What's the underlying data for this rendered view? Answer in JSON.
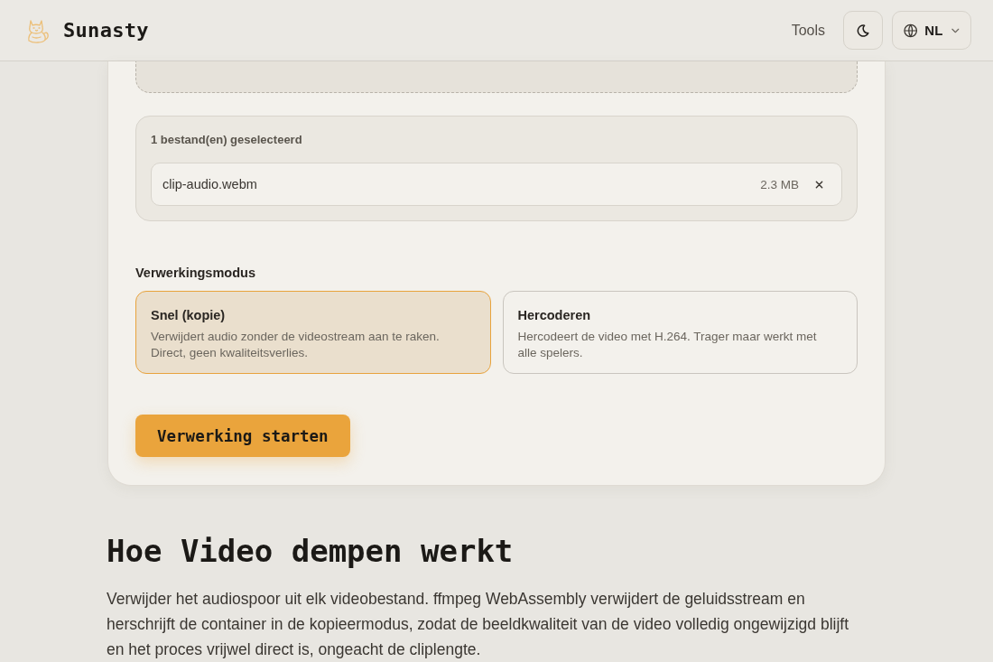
{
  "header": {
    "brand": "Sunasty",
    "nav": [
      {
        "label": "Tools"
      }
    ],
    "language": "NL"
  },
  "converter": {
    "files": {
      "summary": "1 bestand(en) geselecteerd",
      "items": [
        {
          "name": "clip-audio.webm",
          "size": "2.3 MB"
        }
      ]
    },
    "mode_label": "Verwerkingsmodus",
    "modes": [
      {
        "title": "Snel (kopie)",
        "description": "Verwijdert audio zonder de videostream aan te raken. Direct, geen kwaliteitsverlies.",
        "selected": true
      },
      {
        "title": "Hercoderen",
        "description": "Hercodeert de video met H.264. Trager maar werkt met alle spelers.",
        "selected": false
      }
    ],
    "start_button": "Verwerking starten"
  },
  "article": {
    "heading": "Hoe Video dempen werkt",
    "body": "Verwijder het audiospoor uit elk videobestand. ffmpeg WebAssembly verwijdert de geluidsstream en herschrijft de container in de kopieermodus, zodat de beeldkwaliteit van de video volledig ongewijzigd blijft en het proces vrijwel direct is, ongeacht de cliplengte."
  }
}
